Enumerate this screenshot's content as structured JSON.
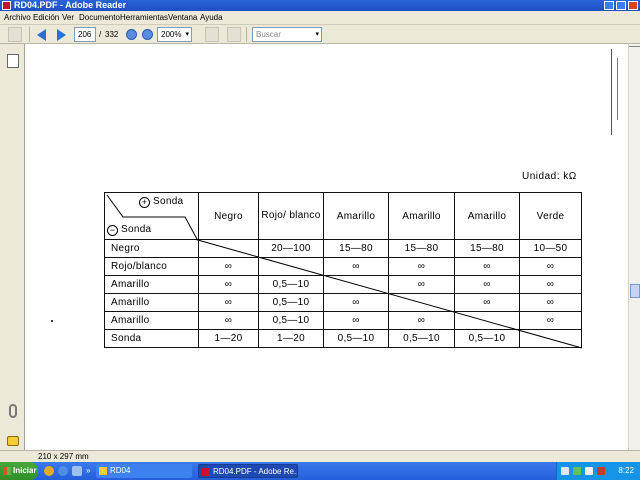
{
  "window": {
    "title": "RD04.PDF - Adobe Reader"
  },
  "menu": [
    "Archivo",
    "Edición",
    "Ver",
    "Documento",
    "Herramientas",
    "Ventana",
    "Ayuda"
  ],
  "toolbar": {
    "page_current": "206",
    "page_separator": "/",
    "page_total": "332",
    "zoom": "200%",
    "search_placeholder": "Buscar"
  },
  "document": {
    "unit_label": "Unidad: kΩ",
    "corner_top": "Sonda",
    "corner_bottom": "Sonda",
    "columns": [
      "Negro",
      "Rojo/ blanco",
      "Amarillo",
      "Amarillo",
      "Amarillo",
      "Verde"
    ],
    "rows": [
      {
        "label": "Negro",
        "cells": [
          "",
          "20—100",
          "15—80",
          "15—80",
          "15—80",
          "10—50"
        ]
      },
      {
        "label": "Rojo/blanco",
        "cells": [
          "∞",
          "",
          "∞",
          "∞",
          "∞",
          "∞"
        ]
      },
      {
        "label": "Amarillo",
        "cells": [
          "∞",
          "0,5—10",
          "",
          "∞",
          "∞",
          "∞"
        ]
      },
      {
        "label": "Amarillo",
        "cells": [
          "∞",
          "0,5—10",
          "∞",
          "",
          "∞",
          "∞"
        ]
      },
      {
        "label": "Amarillo",
        "cells": [
          "∞",
          "0,5—10",
          "∞",
          "∞",
          "",
          "∞"
        ]
      },
      {
        "label": "Sonda",
        "cells": [
          "1—20",
          "1—20",
          "0,5—10",
          "0,5—10",
          "0,5—10",
          ""
        ]
      }
    ]
  },
  "statusbar": {
    "page_size": "210 x 297 mm"
  },
  "taskbar": {
    "start_label": "Iniciar",
    "tasks": [
      "RD04",
      "RD04.PDF - Adobe Re..."
    ],
    "clock": "8:22"
  }
}
